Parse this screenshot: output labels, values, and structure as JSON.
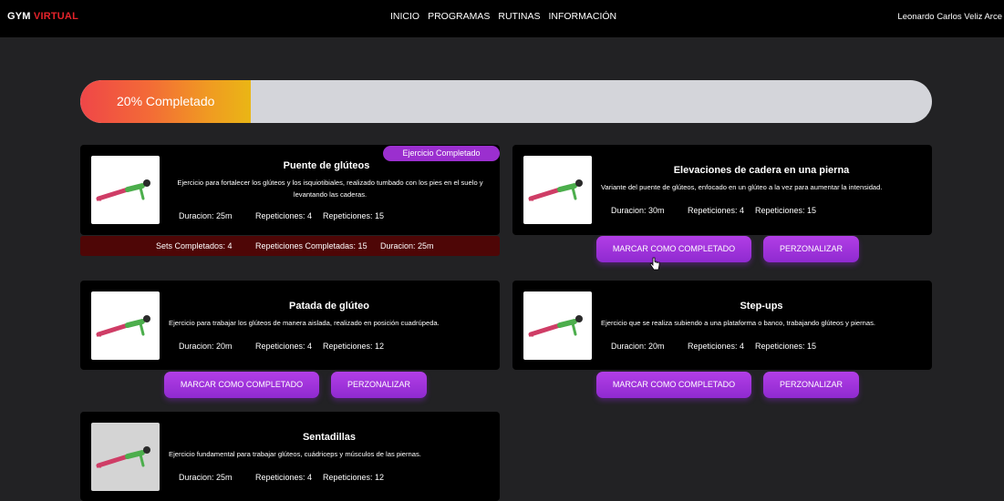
{
  "brand": {
    "part1": "GYM",
    "part2": "VIRTUAL"
  },
  "nav": [
    "INICIO",
    "PROGRAMAS",
    "RUTINAS",
    "INFORMACIÓN"
  ],
  "user": {
    "name": "Leonardo Carlos Veliz Arce"
  },
  "progress": {
    "label": "20% Completado",
    "percent": 20
  },
  "cards": [
    {
      "title": "Puente de glúteos",
      "desc": "Ejercicio para fortalecer los glúteos y los isquiotibiales, realizado tumbado con los pies en el suelo y levantando las caderas.",
      "duration": "Duracion: 25m",
      "reps": "Repeticiones: 4",
      "reps2": "Repeticiones: 15",
      "badge": "Ejercicio Completado",
      "summary": {
        "sets": "Sets Completados: 4",
        "reps": "Repeticiones Completadas: 15",
        "duration": "Duracion: 25m"
      }
    },
    {
      "title": "Elevaciones de cadera en una pierna",
      "desc": "Variante del puente de glúteos, enfocado en un glúteo a la vez para aumentar la intensidad.",
      "duration": "Duracion: 30m",
      "reps": "Repeticiones: 4",
      "reps2": "Repeticiones: 15"
    },
    {
      "title": "Patada de glúteo",
      "desc": "Ejercicio para trabajar los glúteos de manera aislada, realizado en posición cuadrúpeda.",
      "duration": "Duracion: 20m",
      "reps": "Repeticiones: 4",
      "reps2": "Repeticiones: 12"
    },
    {
      "title": "Step-ups",
      "desc": "Ejercicio que se realiza subiendo a una plataforma o banco, trabajando glúteos y piernas.",
      "duration": "Duracion: 20m",
      "reps": "Repeticiones: 4",
      "reps2": "Repeticiones: 15"
    },
    {
      "title": "Sentadillas",
      "desc": "Ejercicio fundamental para trabajar glúteos, cuádriceps y músculos de las piernas.",
      "duration": "Duracion: 25m",
      "reps": "Repeticiones: 4",
      "reps2": "Repeticiones: 12"
    }
  ],
  "buttons": {
    "complete": "MARCAR COMO COMPLETADO",
    "customize": "PERZONALIZAR"
  },
  "colors": {
    "accent": "#9b2fcf",
    "brand_red": "#e5232b",
    "card_bg": "#000000",
    "page_bg": "#222224"
  }
}
